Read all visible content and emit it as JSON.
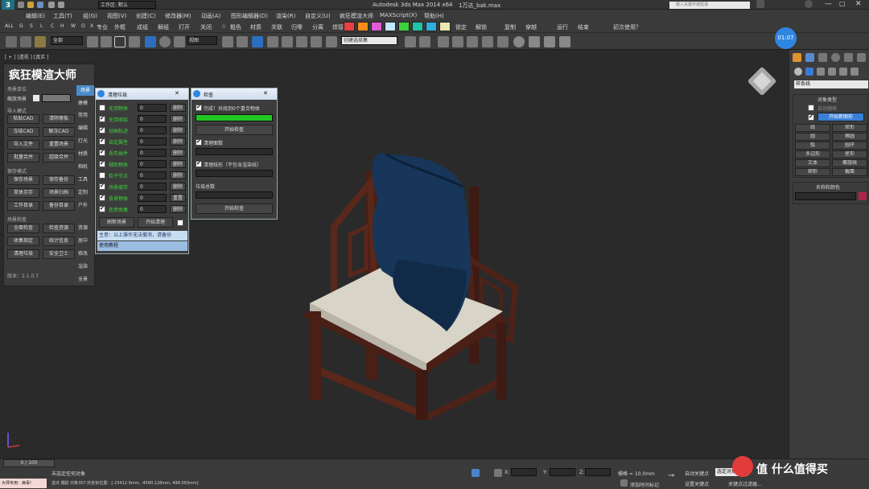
{
  "title_bar": {
    "workspace_label": "工作区: 默认",
    "app_title": "Autodesk 3ds Max  2014 x64",
    "file_name": "1万达_bak.max",
    "search_placeholder": "键入关键字或短语",
    "clock": "01:07"
  },
  "menu": [
    "编辑(E)",
    "工具(T)",
    "组(G)",
    "视图(V)",
    "创建(C)",
    "修改器(M)",
    "动画(A)",
    "图形编辑器(D)",
    "渲染(R)",
    "自定义(U)",
    "疯狂模渲大师",
    "MAXScript(X)",
    "帮助(H)"
  ],
  "toolbar1": {
    "filters": [
      "ALL",
      "G",
      "S",
      "L",
      "C",
      "H",
      "W",
      "O",
      "X"
    ],
    "items": [
      "专业",
      "外框",
      "成组",
      "解组",
      "打开",
      "关闭",
      "☆",
      "粗色",
      "材质",
      "关联",
      "归零",
      "分离",
      "焊接"
    ],
    "colors": [
      "#e84040",
      "#ff8c1a",
      "#e05bd8",
      "#c2e6ff",
      "#3ecf3e",
      "#1ec4a4",
      "#2fb0e0",
      "#e8e8b0"
    ],
    "right_items": [
      "锁定",
      "解锁",
      "复制",
      "穿越",
      "运行",
      "结束",
      "初次使用？"
    ]
  },
  "toolbar2": {
    "filter_value": "全部",
    "view_value": "视图",
    "selection_set": "创建选择集"
  },
  "viewport": {
    "label": "[ + ] [透视 ] [真实 ]"
  },
  "plugin": {
    "title": "疯狂模渲大师",
    "scene_unit_label": "场景单位",
    "scale_scene_label": "缩放场景",
    "import_mode_label": "导入模式",
    "import_buttons": [
      "粘贴CAD",
      "清除傢俬",
      "冻结CAD",
      "解冻CAD",
      "导入文件",
      "重置场景",
      "批量合并",
      "超级合并"
    ],
    "save_mode_label": "保存模式",
    "save_buttons": [
      "保存场景",
      "保存备份",
      "单体另存",
      "场景归档",
      "工作目录",
      "备份目录"
    ],
    "check_label": "场景检查",
    "check_buttons": [
      "全面检查",
      "检查资源",
      "收集指定",
      "统计信息",
      "清理垃圾",
      "安全卫士"
    ],
    "version": "版本：2.1.0.7",
    "tabs": [
      "场景",
      "建模",
      "常用",
      "编辑",
      "灯光",
      "材质",
      "相机",
      "工具",
      "定制",
      "户外",
      "资源",
      "居中",
      "修改",
      "渲染",
      "全景"
    ]
  },
  "cleanup_panel": {
    "title": "清理垃圾",
    "rows": [
      {
        "label": "无用物体",
        "value": "0",
        "checked": false
      },
      {
        "label": "无用图层",
        "value": "0",
        "checked": true
      },
      {
        "label": "动画轨迹",
        "value": "0",
        "checked": true
      },
      {
        "label": "自定属性",
        "value": "0",
        "checked": true
      },
      {
        "label": "丢失插件",
        "value": "0",
        "checked": true
      },
      {
        "label": "辅助物体",
        "value": "0",
        "checked": true
      },
      {
        "label": "粒子节点",
        "value": "0",
        "checked": false
      },
      {
        "label": "场景缓存",
        "value": "0",
        "checked": true
      },
      {
        "label": "背景物体",
        "value": "0",
        "checked": true
      },
      {
        "label": "恶意病毒",
        "value": "0",
        "checked": true
      }
    ],
    "delete_label": "删除",
    "reset_label": "重置",
    "refresh_button": "刷新场景",
    "start_button": "开始清理",
    "note": "主意：以上操作无法撤消，请备份",
    "tutorial": "使用教程"
  },
  "check_panel": {
    "title": "检查",
    "done_text": "完成！共找到0个重合物体",
    "progress": 1.0,
    "start_button_1": "开始检查",
    "clean_surface": "清理面数",
    "clean_lines": "清理线形（不包含渲染线）",
    "garbage_total": "垃圾总数",
    "start_button_2": "开始检查"
  },
  "command_panel": {
    "dropdown": "样条线",
    "object_type_label": "对象类型",
    "auto_grid": "自动栅格",
    "start_new_shape": "开始新图形",
    "shapes": [
      "线",
      "矩形",
      "圆",
      "椭圆",
      "弧",
      "圆环",
      "多边形",
      "星形",
      "文本",
      "螺旋线",
      "卵形",
      "截面"
    ],
    "name_color_label": "名称和颜色"
  },
  "timeline": {
    "frame": "0 / 100"
  },
  "status": {
    "left_label": "大师专用：病毒!",
    "no_selection": "未选定任何对象",
    "prompt": "选点 捕捉 对象307 的坐标位置：[-23412.9mm, -4580.128mm, 498.093mm]",
    "x_label": "X:",
    "y_label": "Y:",
    "z_label": "Z:",
    "grid": "栅格 = 10.0mm",
    "auto_key": "自动关键点",
    "set_key": "设置关键点",
    "selected_object": "选定对象",
    "add_time_tag": "添加时间标记",
    "key_filter": "关键点过滤器...",
    "watermark": "值 什么值得买"
  }
}
